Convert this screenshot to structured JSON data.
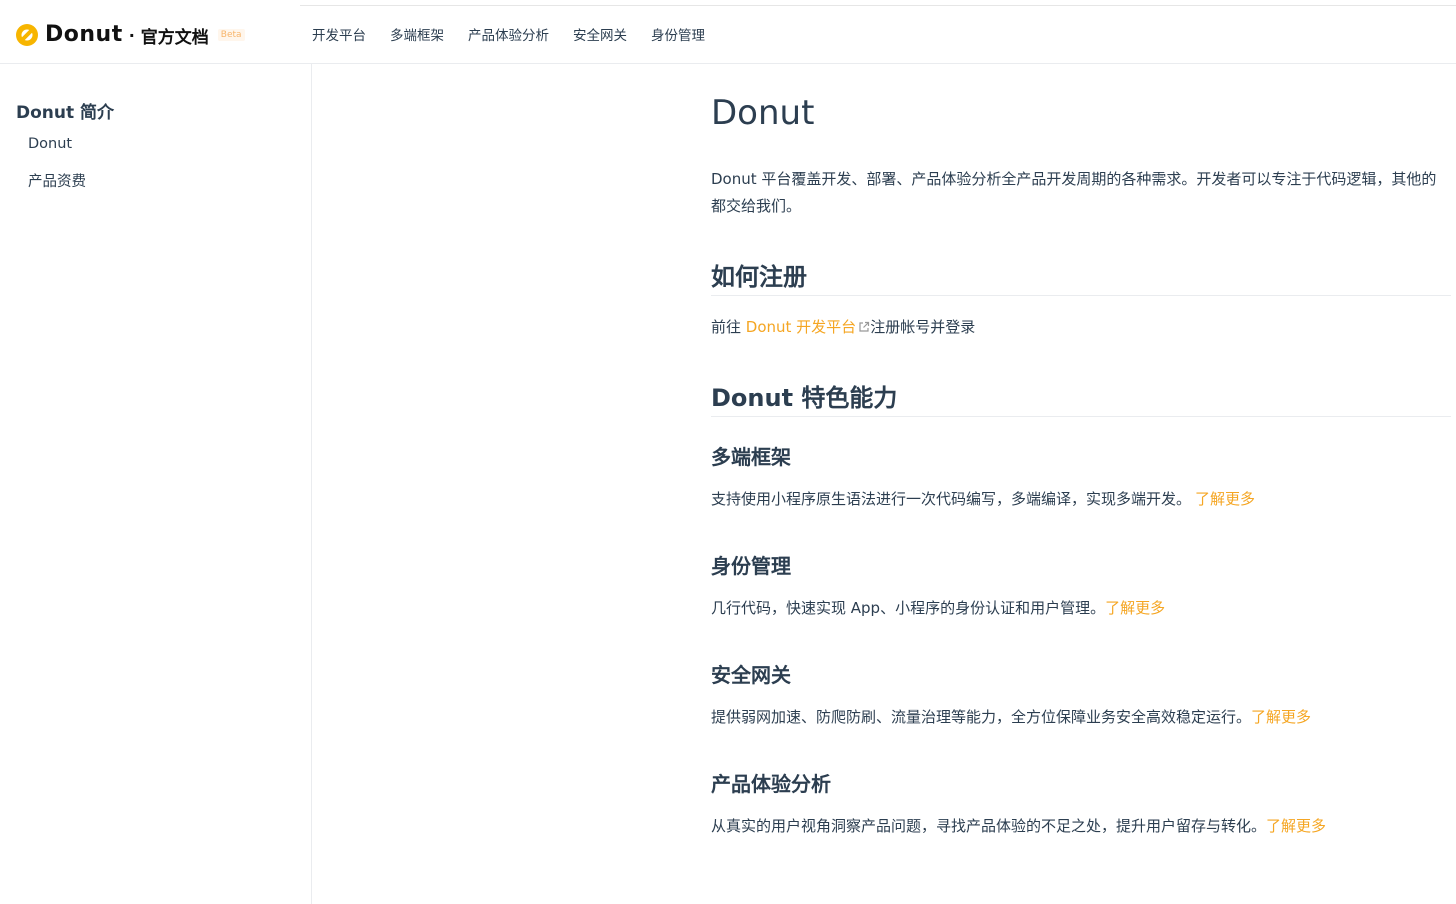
{
  "brand": {
    "name": "Donut",
    "separator": "·",
    "subtitle": "官方文档",
    "badge": "Beta"
  },
  "topnav": [
    "开发平台",
    "多端框架",
    "产品体验分析",
    "安全网关",
    "身份管理"
  ],
  "sidebar": {
    "title": "Donut 简介",
    "items": [
      "Donut",
      "产品资费"
    ]
  },
  "content": {
    "title": "Donut",
    "intro": "Donut 平台覆盖开发、部署、产品体验分析全产品开发周期的各种需求。开发者可以专注于代码逻辑，其他的都交给我们。",
    "register_heading": "如何注册",
    "register_prefix": "前往 ",
    "register_link": "Donut 开发平台",
    "register_suffix": "注册帐号并登录",
    "features_heading": "Donut 特色能力",
    "features": [
      {
        "title": "多端框架",
        "desc": "支持使用小程序原生语法进行一次代码编写，多端编译，实现多端开发。",
        "more": "了解更多"
      },
      {
        "title": "身份管理",
        "desc": "几行代码，快速实现 App、小程序的身份认证和用户管理。",
        "more": "了解更多"
      },
      {
        "title": "安全网关",
        "desc": "提供弱网加速、防爬防刷、流量治理等能力，全方位保障业务安全高效稳定运行。",
        "more": "了解更多"
      },
      {
        "title": "产品体验分析",
        "desc": "从真实的用户视角洞察产品问题，寻找产品体验的不足之处，提升用户留存与转化。",
        "more": "了解更多"
      }
    ]
  },
  "colors": {
    "accent": "#f5a623",
    "text": "#2c3e50",
    "border": "#eaecef"
  },
  "icons": {
    "logo": "donut-logo",
    "external": "external-link-icon"
  }
}
